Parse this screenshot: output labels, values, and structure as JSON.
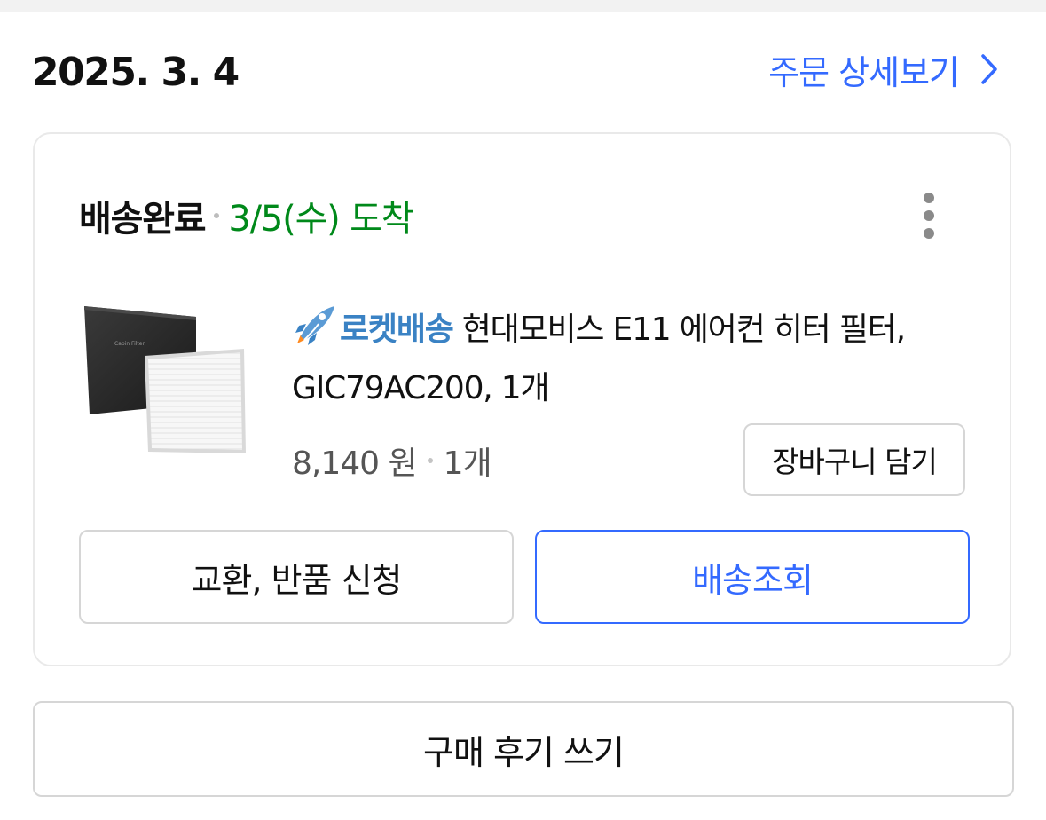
{
  "order": {
    "date": "2025. 3. 4",
    "detail_link_label": "주문 상세보기"
  },
  "delivery": {
    "status": "배송완료",
    "arrival": "3/5(수) 도착"
  },
  "product": {
    "badge_label": "로켓배송",
    "name": "현대모비스 E11 에어컨 히터 필터, GIC79AC200, 1개",
    "thumbnail_label": "Cabin Filter",
    "price": "8,140 원",
    "quantity": "1개"
  },
  "actions": {
    "add_to_cart": "장바구니 담기",
    "exchange_return": "교환, 반품 신청",
    "track_delivery": "배송조회",
    "write_review": "구매 후기 쓰기"
  },
  "colors": {
    "accent_blue": "#346aff",
    "delivered_green": "#00891a",
    "rocket_blue": "#3a82c4"
  }
}
